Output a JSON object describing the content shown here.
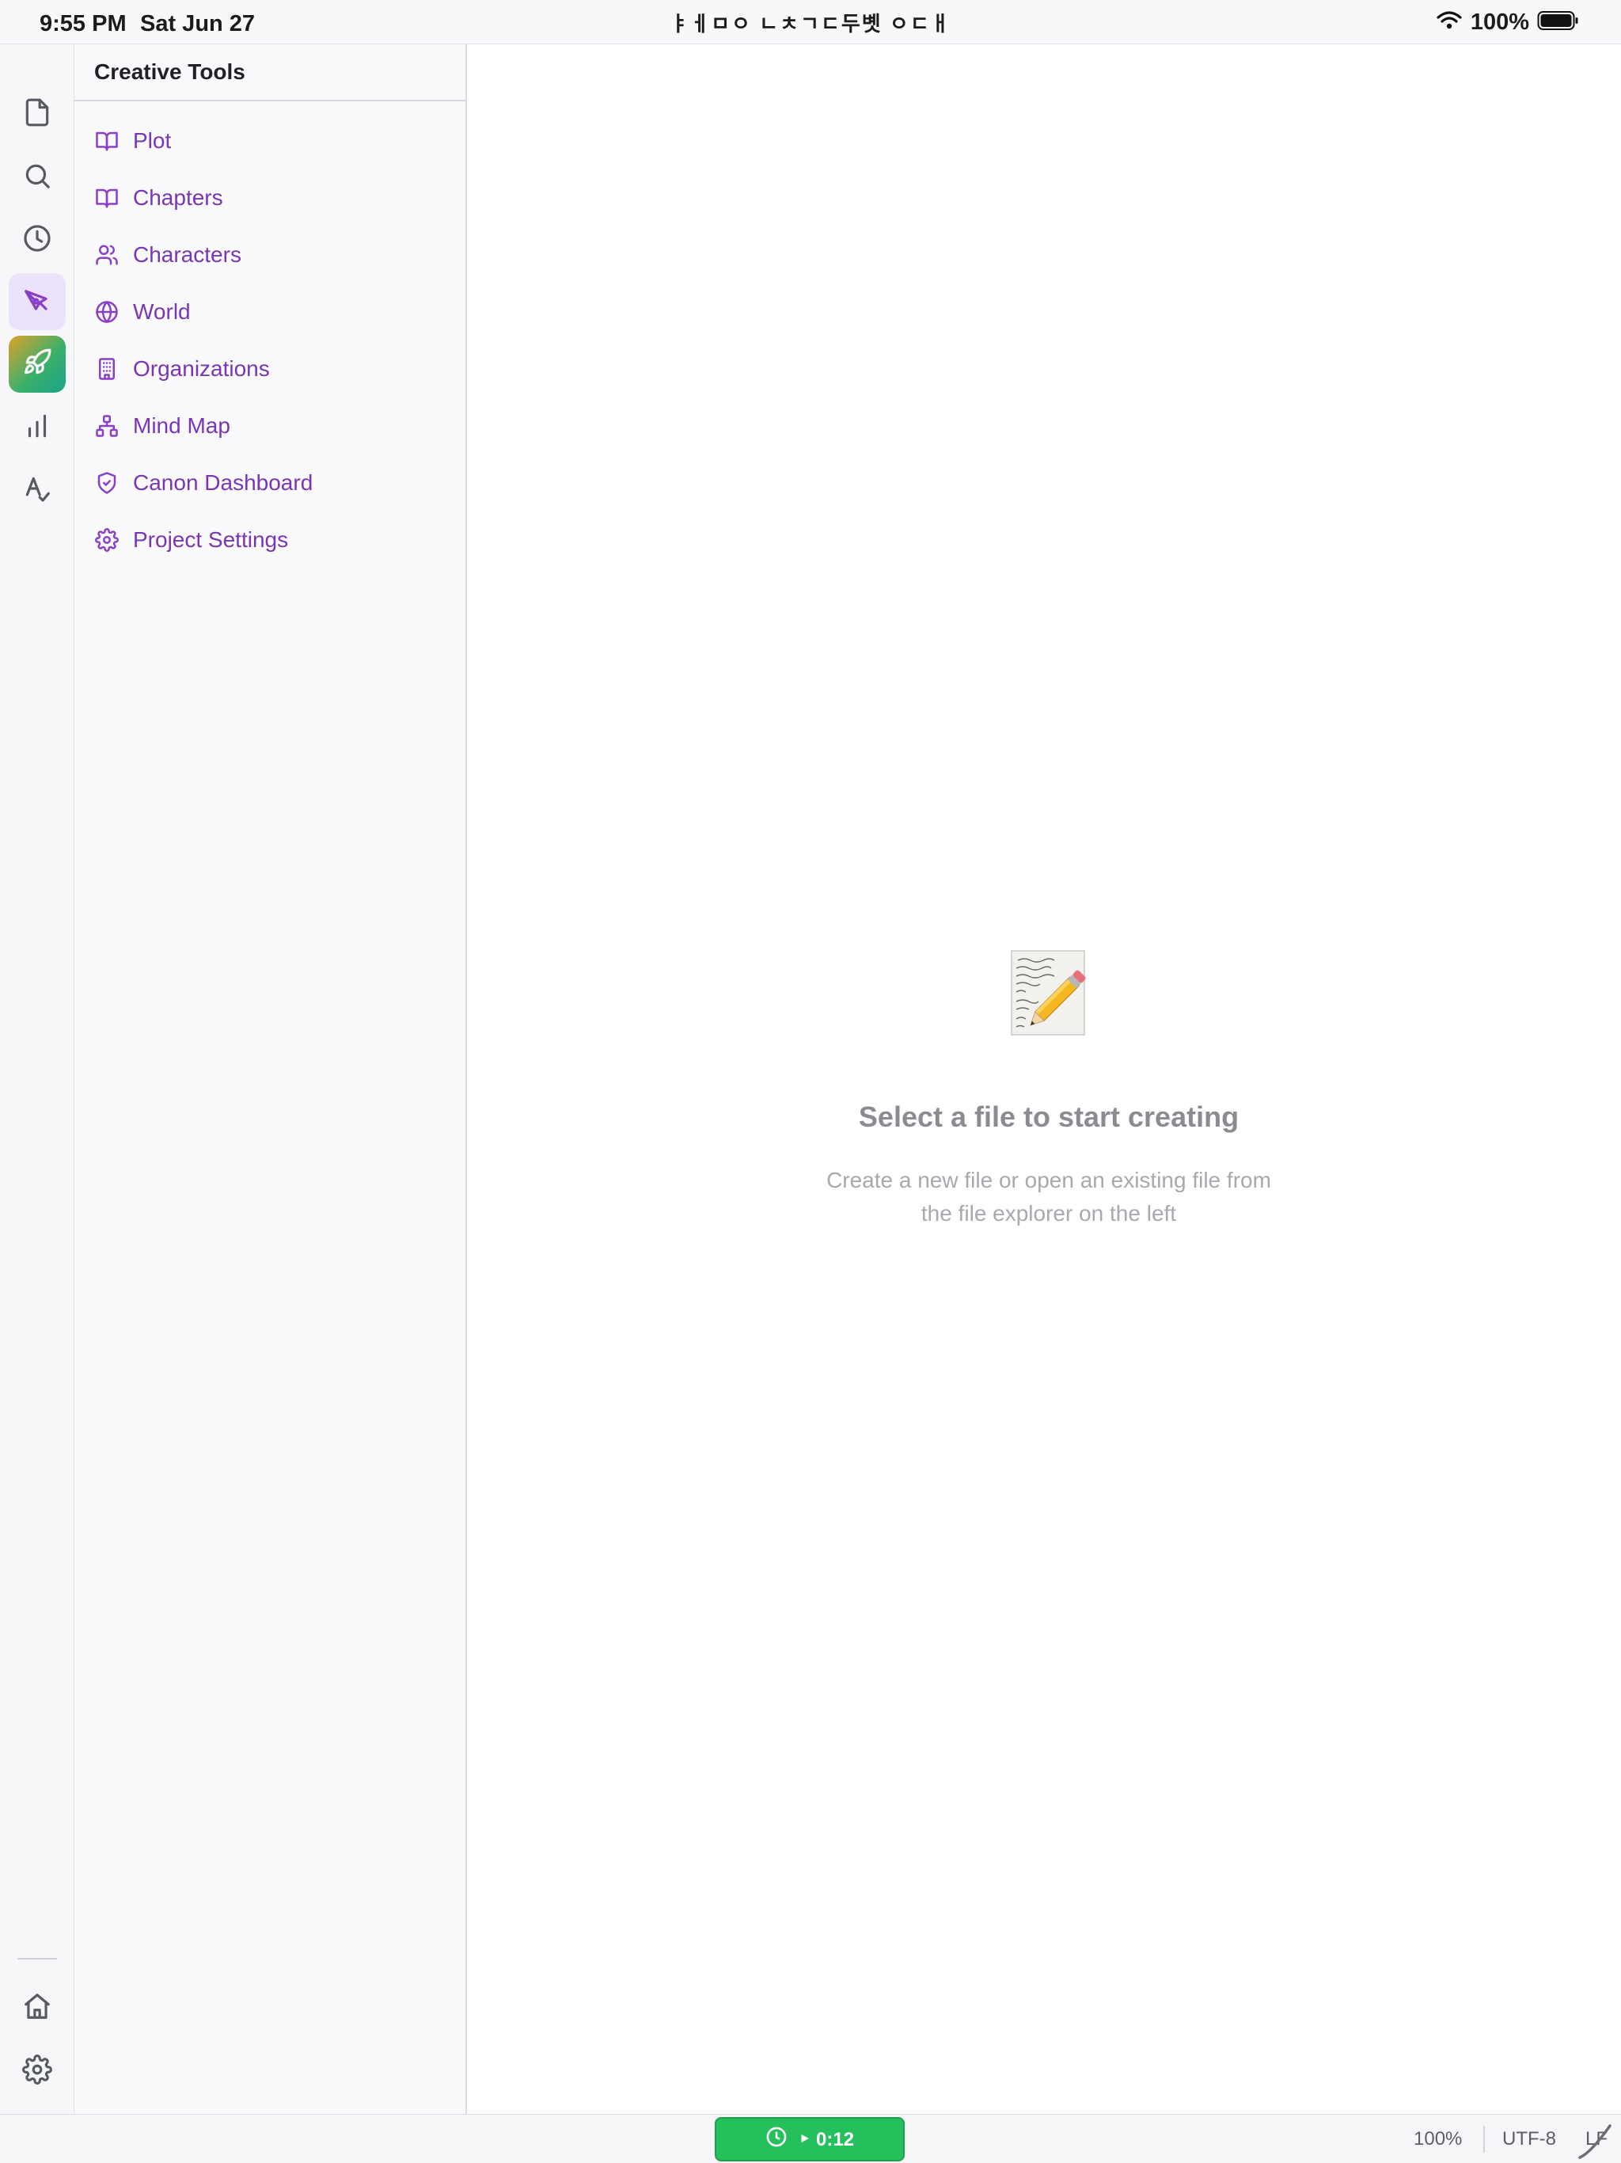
{
  "status_bar": {
    "time": "9:55 PM",
    "date": "Sat Jun 27",
    "title": "ㅑㅔㅁㅇ ㄴㅊㄱㄷ두볫 ㅇㄷㅐ",
    "battery": "100%",
    "icons": [
      "wifi-icon",
      "battery-icon"
    ]
  },
  "rail": {
    "items": [
      {
        "name": "files",
        "icon": "file-icon"
      },
      {
        "name": "search",
        "icon": "search-icon"
      },
      {
        "name": "recent",
        "icon": "clock-icon"
      },
      {
        "name": "creative-tools",
        "icon": "pen-tool-icon",
        "active": true
      },
      {
        "name": "launch",
        "icon": "rocket-icon"
      },
      {
        "name": "stats",
        "icon": "bar-chart-icon"
      },
      {
        "name": "spellcheck",
        "icon": "spellcheck-icon"
      }
    ],
    "bottom": [
      {
        "name": "home",
        "icon": "home-icon"
      },
      {
        "name": "settings",
        "icon": "gear-icon"
      }
    ]
  },
  "sidebar": {
    "title": "Creative Tools",
    "items": [
      {
        "label": "Plot",
        "icon": "book-open-icon"
      },
      {
        "label": "Chapters",
        "icon": "book-open-icon"
      },
      {
        "label": "Characters",
        "icon": "users-icon"
      },
      {
        "label": "World",
        "icon": "globe-icon"
      },
      {
        "label": "Organizations",
        "icon": "building-icon"
      },
      {
        "label": "Mind Map",
        "icon": "network-icon"
      },
      {
        "label": "Canon Dashboard",
        "icon": "shield-check-icon"
      },
      {
        "label": "Project Settings",
        "icon": "gear-icon"
      }
    ]
  },
  "main": {
    "empty_icon": "memo-pencil-icon",
    "title": "Select a file to start creating",
    "subtitle_line1": "Create a new file or open an existing file from",
    "subtitle_line2": "the file explorer on the left"
  },
  "bottom_bar": {
    "timer_label": "‣ 0:12",
    "timer_icon": "clock-icon",
    "zoom": "100%",
    "encoding": "UTF-8",
    "line_ending": "LF",
    "colors": {
      "timer": "#25c05c",
      "accent": "#8a3fc8"
    }
  }
}
